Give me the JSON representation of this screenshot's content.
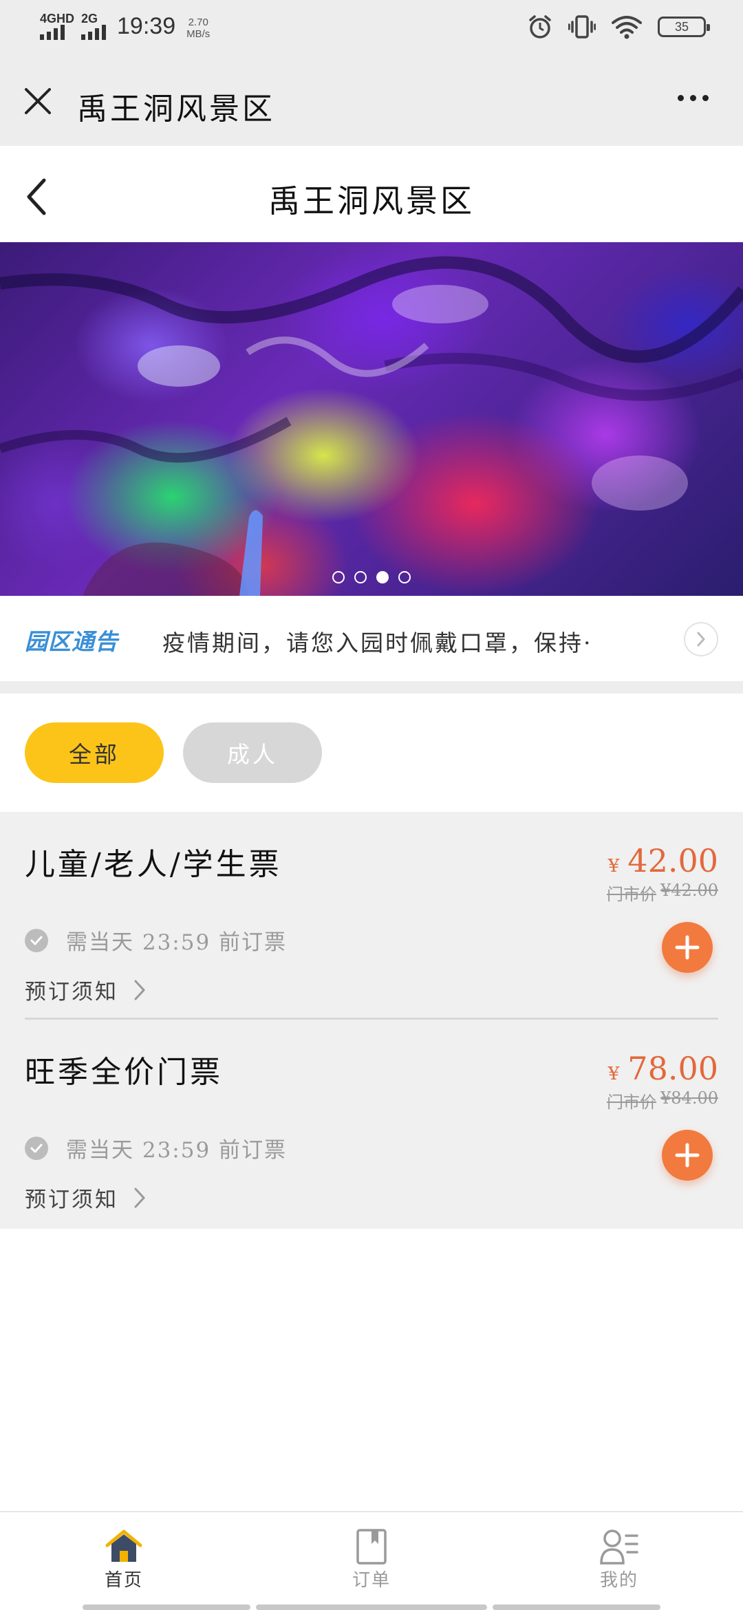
{
  "status_bar": {
    "net1": "4GHD",
    "net2": "2G",
    "time": "19:39",
    "speed_value": "2.70",
    "speed_unit": "MB/s",
    "battery": "35"
  },
  "wechat_bar": {
    "title": "禹王洞风景区"
  },
  "header": {
    "title": "禹王洞风景区"
  },
  "banner": {
    "slide_count": 4,
    "active_index": 2
  },
  "notice": {
    "logo": "园区通告",
    "text": "疫情期间，请您入园时佩戴口罩，保持···"
  },
  "filters": [
    {
      "label": "全部",
      "selected": true
    },
    {
      "label": "成人",
      "selected": false
    }
  ],
  "tickets": [
    {
      "name": "儿童/老人/学生票",
      "currency": "¥",
      "price": "42.00",
      "orig_label": "门市价",
      "orig_price": "¥42.00",
      "condition": "需当天 23:59 前订票",
      "notice": "预订须知"
    },
    {
      "name": "旺季全价门票",
      "currency": "¥",
      "price": "78.00",
      "orig_label": "门市价",
      "orig_price": "¥84.00",
      "condition": "需当天 23:59 前订票",
      "notice": "预订须知"
    }
  ],
  "nav": {
    "home": "首页",
    "orders": "订单",
    "mine": "我的"
  },
  "colors": {
    "accent_yellow": "#fcc419",
    "price_orange": "#e3683b",
    "add_button": "#f27a3e",
    "notice_blue": "#3a8fd6"
  },
  "icons": [
    "close-icon",
    "more-icon",
    "back-icon",
    "chevron-right-icon",
    "check-icon",
    "plus-icon",
    "home-icon",
    "orders-icon",
    "profile-icon",
    "alarm-icon",
    "vibrate-icon",
    "wifi-icon",
    "battery-icon"
  ]
}
